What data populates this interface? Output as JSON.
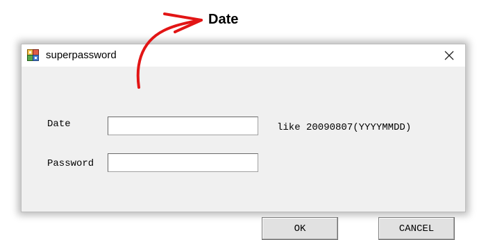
{
  "annotation": {
    "label": "Date",
    "arrow_color": "#e21515"
  },
  "window": {
    "title": "superpassword",
    "icon": "app-blocks-icon",
    "close_icon": "close-icon"
  },
  "form": {
    "date_label": "Date",
    "date_value": "",
    "date_hint": "like 20090807(YYYYMMDD)",
    "password_label": "Password",
    "password_value": ""
  },
  "buttons": {
    "ok_label": "OK",
    "cancel_label": "CANCEL"
  }
}
